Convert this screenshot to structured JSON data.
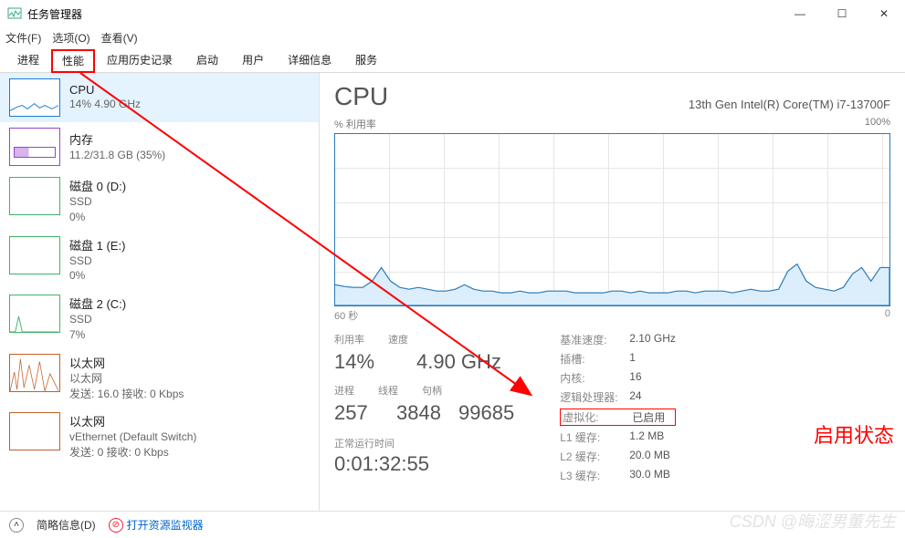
{
  "window": {
    "title": "任务管理器"
  },
  "menu": {
    "file": "文件(F)",
    "options": "选项(O)",
    "view": "查看(V)"
  },
  "tabs": {
    "processes": "进程",
    "performance": "性能",
    "appHistory": "应用历史记录",
    "startup": "启动",
    "users": "用户",
    "details": "详细信息",
    "services": "服务"
  },
  "sidebar": {
    "cpu": {
      "title": "CPU",
      "sub": "14%  4.90 GHz"
    },
    "mem": {
      "title": "内存",
      "sub": "11.2/31.8 GB (35%)"
    },
    "disk0": {
      "title": "磁盘 0 (D:)",
      "sub1": "SSD",
      "sub2": "0%"
    },
    "disk1": {
      "title": "磁盘 1 (E:)",
      "sub1": "SSD",
      "sub2": "0%"
    },
    "disk2": {
      "title": "磁盘 2 (C:)",
      "sub1": "SSD",
      "sub2": "7%"
    },
    "eth0": {
      "title": "以太网",
      "sub1": "以太网",
      "sub2": "发送: 16.0  接收: 0 Kbps"
    },
    "eth1": {
      "title": "以太网",
      "sub1": "vEthernet (Default Switch)",
      "sub2": "发送: 0  接收: 0 Kbps"
    }
  },
  "detail": {
    "title": "CPU",
    "model": "13th Gen Intel(R) Core(TM) i7-13700F",
    "graph_label": "% 利用率",
    "graph_max": "100%",
    "axis_left": "60 秒",
    "axis_right": "0",
    "stat_labels": {
      "util": "利用率",
      "speed": "速度",
      "proc": "进程",
      "threads": "线程",
      "handles": "句柄"
    },
    "stat_values": {
      "util": "14%",
      "speed": "4.90 GHz",
      "proc": "257",
      "threads": "3848",
      "handles": "99685"
    },
    "uptime_label": "正常运行时间",
    "uptime_value": "0:01:32:55",
    "kv": {
      "base_speed_k": "基准速度:",
      "base_speed_v": "2.10 GHz",
      "sockets_k": "插槽:",
      "sockets_v": "1",
      "cores_k": "内核:",
      "cores_v": "16",
      "logical_k": "逻辑处理器:",
      "logical_v": "24",
      "virt_k": "虚拟化:",
      "virt_v": "已启用",
      "l1_k": "L1 缓存:",
      "l1_v": "1.2 MB",
      "l2_k": "L2 缓存:",
      "l2_v": "20.0 MB",
      "l3_k": "L3 缓存:",
      "l3_v": "30.0 MB"
    }
  },
  "footer": {
    "brief": "简略信息(D)",
    "resmon": "打开资源监视器"
  },
  "annotation": {
    "status": "启用状态"
  },
  "watermark": "CSDN @晦涩男董先生",
  "chart_data": {
    "type": "line",
    "title": "% 利用率",
    "xlabel": "",
    "ylabel": "% 利用率",
    "xlim": [
      0,
      60
    ],
    "ylim": [
      0,
      100
    ],
    "x_axis_note": "60 秒 → 0",
    "series": [
      {
        "name": "CPU Utilization %",
        "values": [
          12,
          11,
          10,
          10,
          14,
          22,
          14,
          10,
          9,
          10,
          9,
          8,
          8,
          9,
          12,
          9,
          8,
          8,
          7,
          7,
          8,
          7,
          7,
          8,
          8,
          8,
          7,
          7,
          7,
          7,
          8,
          8,
          7,
          8,
          7,
          7,
          7,
          8,
          8,
          7,
          8,
          8,
          8,
          7,
          8,
          9,
          8,
          8,
          9,
          20,
          24,
          14,
          10,
          9,
          8,
          10,
          18,
          22,
          14,
          22
        ]
      }
    ]
  }
}
